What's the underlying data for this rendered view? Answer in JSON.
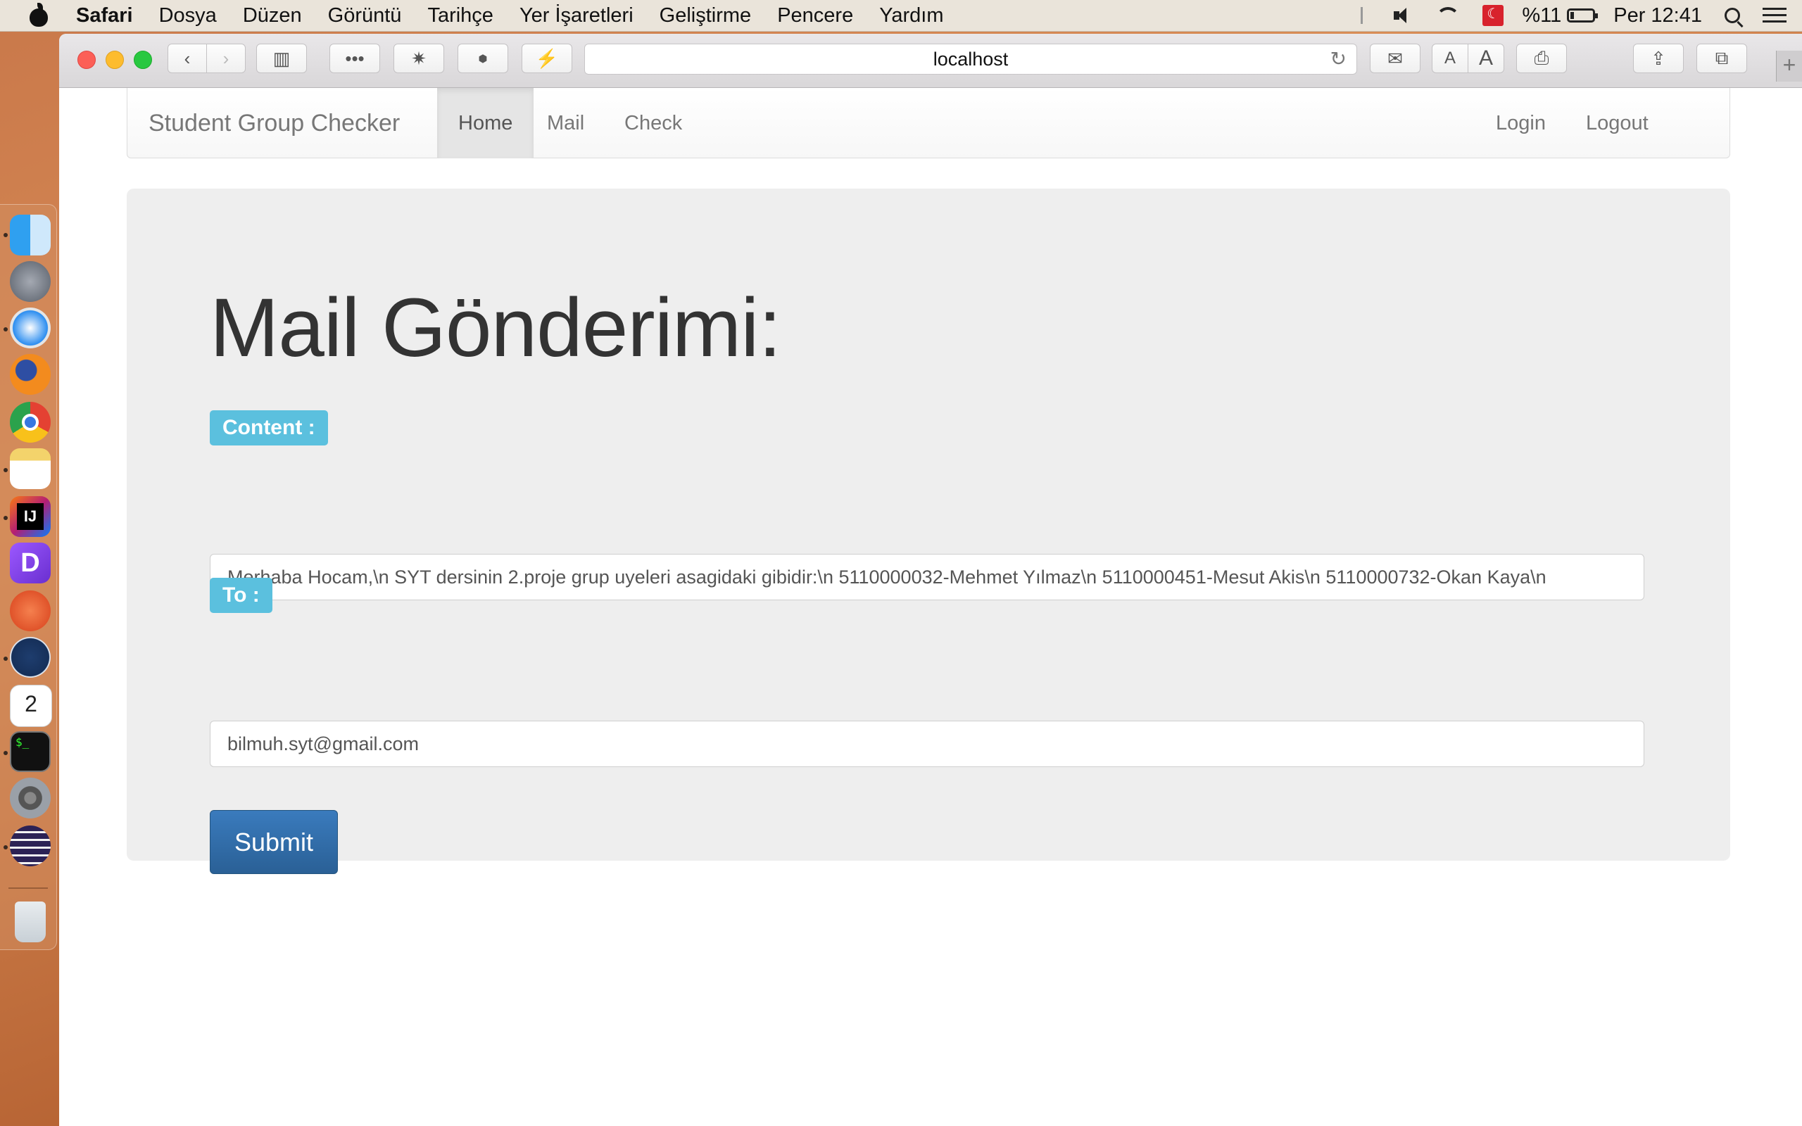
{
  "menubar": {
    "app": "Safari",
    "menus": [
      "Dosya",
      "Düzen",
      "Görüntü",
      "Tarihçe",
      "Yer İşaretleri",
      "Geliştirme",
      "Pencere",
      "Yardım"
    ],
    "battery": "%11",
    "clock": "Per 12:41"
  },
  "dock": {
    "icons": [
      "finder-icon",
      "launchpad-icon",
      "safari-icon",
      "firefox-icon",
      "chrome-icon",
      "notes-icon",
      "intellij-icon",
      "dash-icon",
      "pen-icon",
      "sourcetree-icon",
      "calendar-icon",
      "terminal-icon",
      "system-preferences-icon",
      "eclipse-icon",
      "trash-icon"
    ]
  },
  "browser": {
    "url": "localhost"
  },
  "navbar": {
    "brand": "Student Group Checker",
    "links": [
      "Home",
      "Mail",
      "Check"
    ],
    "right_links": [
      "Login",
      "Logout"
    ]
  },
  "form": {
    "heading": "Mail Gönderimi:",
    "content_label": "Content :",
    "content_value": "Merhaba Hocam,\\n SYT dersinin 2.proje grup uyeleri asagidaki gibidir:\\n 5110000032-Mehmet Yılmaz\\n 5110000451-Mesut Akis\\n 5110000732-Okan Kaya\\n",
    "to_label": "To :",
    "to_value": "bilmuh.syt@gmail.com",
    "submit": "Submit"
  },
  "colors": {
    "label_bg": "#5bc0de",
    "button_bg": "#2f6ea8",
    "jumbotron_bg": "#eeeeee"
  }
}
